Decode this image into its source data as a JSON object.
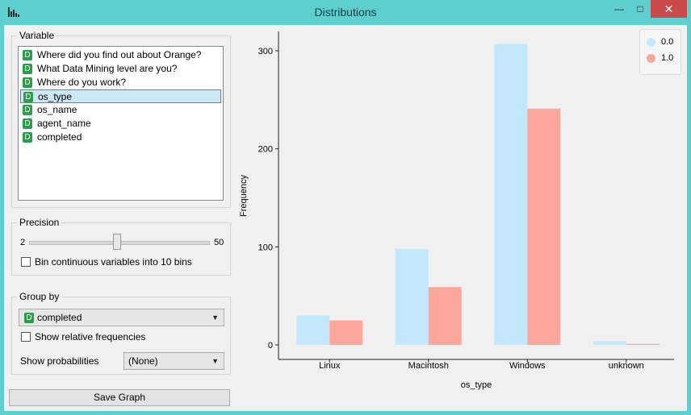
{
  "window": {
    "title": "Distributions",
    "min_glyph": "—",
    "max_glyph": "□",
    "close_glyph": "✕"
  },
  "variable_box": {
    "title": "Variable",
    "items": [
      {
        "badge": "D",
        "label": "Where did you find out about Orange?",
        "selected": false
      },
      {
        "badge": "D",
        "label": "What Data Mining level are you?",
        "selected": false
      },
      {
        "badge": "D",
        "label": "Where do you work?",
        "selected": false
      },
      {
        "badge": "D",
        "label": "os_type",
        "selected": true
      },
      {
        "badge": "D",
        "label": "os_name",
        "selected": false
      },
      {
        "badge": "D",
        "label": "agent_name",
        "selected": false
      },
      {
        "badge": "D",
        "label": "completed",
        "selected": false
      }
    ]
  },
  "precision_box": {
    "title": "Precision",
    "slider_min": "2",
    "slider_max": "50",
    "slider_fraction": 0.49,
    "bin_checkbox_label": "Bin continuous variables into 10 bins",
    "bin_checked": false
  },
  "group_box": {
    "title": "Group by",
    "group_value_badge": "D",
    "group_value": "completed",
    "relative_label": "Show relative frequencies",
    "relative_checked": false,
    "prob_label": "Show probabilities",
    "prob_value": "(None)"
  },
  "save_button": "Save Graph",
  "colors": {
    "series0": "#c3e8fb",
    "series1": "#fca79b",
    "accent": "#5ecfcf",
    "selection": "#cce8f6"
  },
  "chart_data": {
    "type": "bar",
    "categories": [
      "Linux",
      "Macintosh",
      "Windows",
      "unknown"
    ],
    "series": [
      {
        "name": "0.0",
        "values": [
          30,
          98,
          307,
          4
        ]
      },
      {
        "name": "1.0",
        "values": [
          25,
          59,
          241,
          1
        ]
      }
    ],
    "xlabel": "os_type",
    "ylabel": "Frequency",
    "yticks": [
      "0",
      "100",
      "200",
      "300"
    ],
    "ylim": [
      0,
      320
    ],
    "legend_position": "top-right",
    "grid": false
  }
}
